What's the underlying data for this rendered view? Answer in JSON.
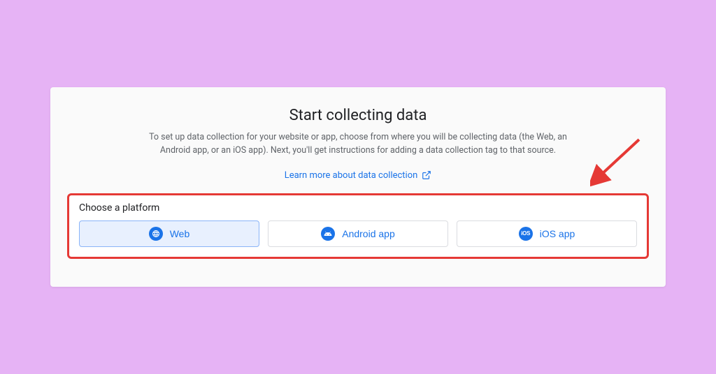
{
  "header": {
    "title": "Start collecting data",
    "description": "To set up data collection for your website or app, choose from where you will be collecting data (the Web, an Android app, or an iOS app). Next, you'll get instructions for adding a data collection tag to that source.",
    "learnMore": "Learn more about data collection"
  },
  "platformSection": {
    "label": "Choose a platform",
    "options": {
      "web": "Web",
      "android": "Android app",
      "ios": "iOS app"
    }
  },
  "annotation": {
    "highlightColor": "#e53935",
    "arrowColor": "#e53935"
  }
}
